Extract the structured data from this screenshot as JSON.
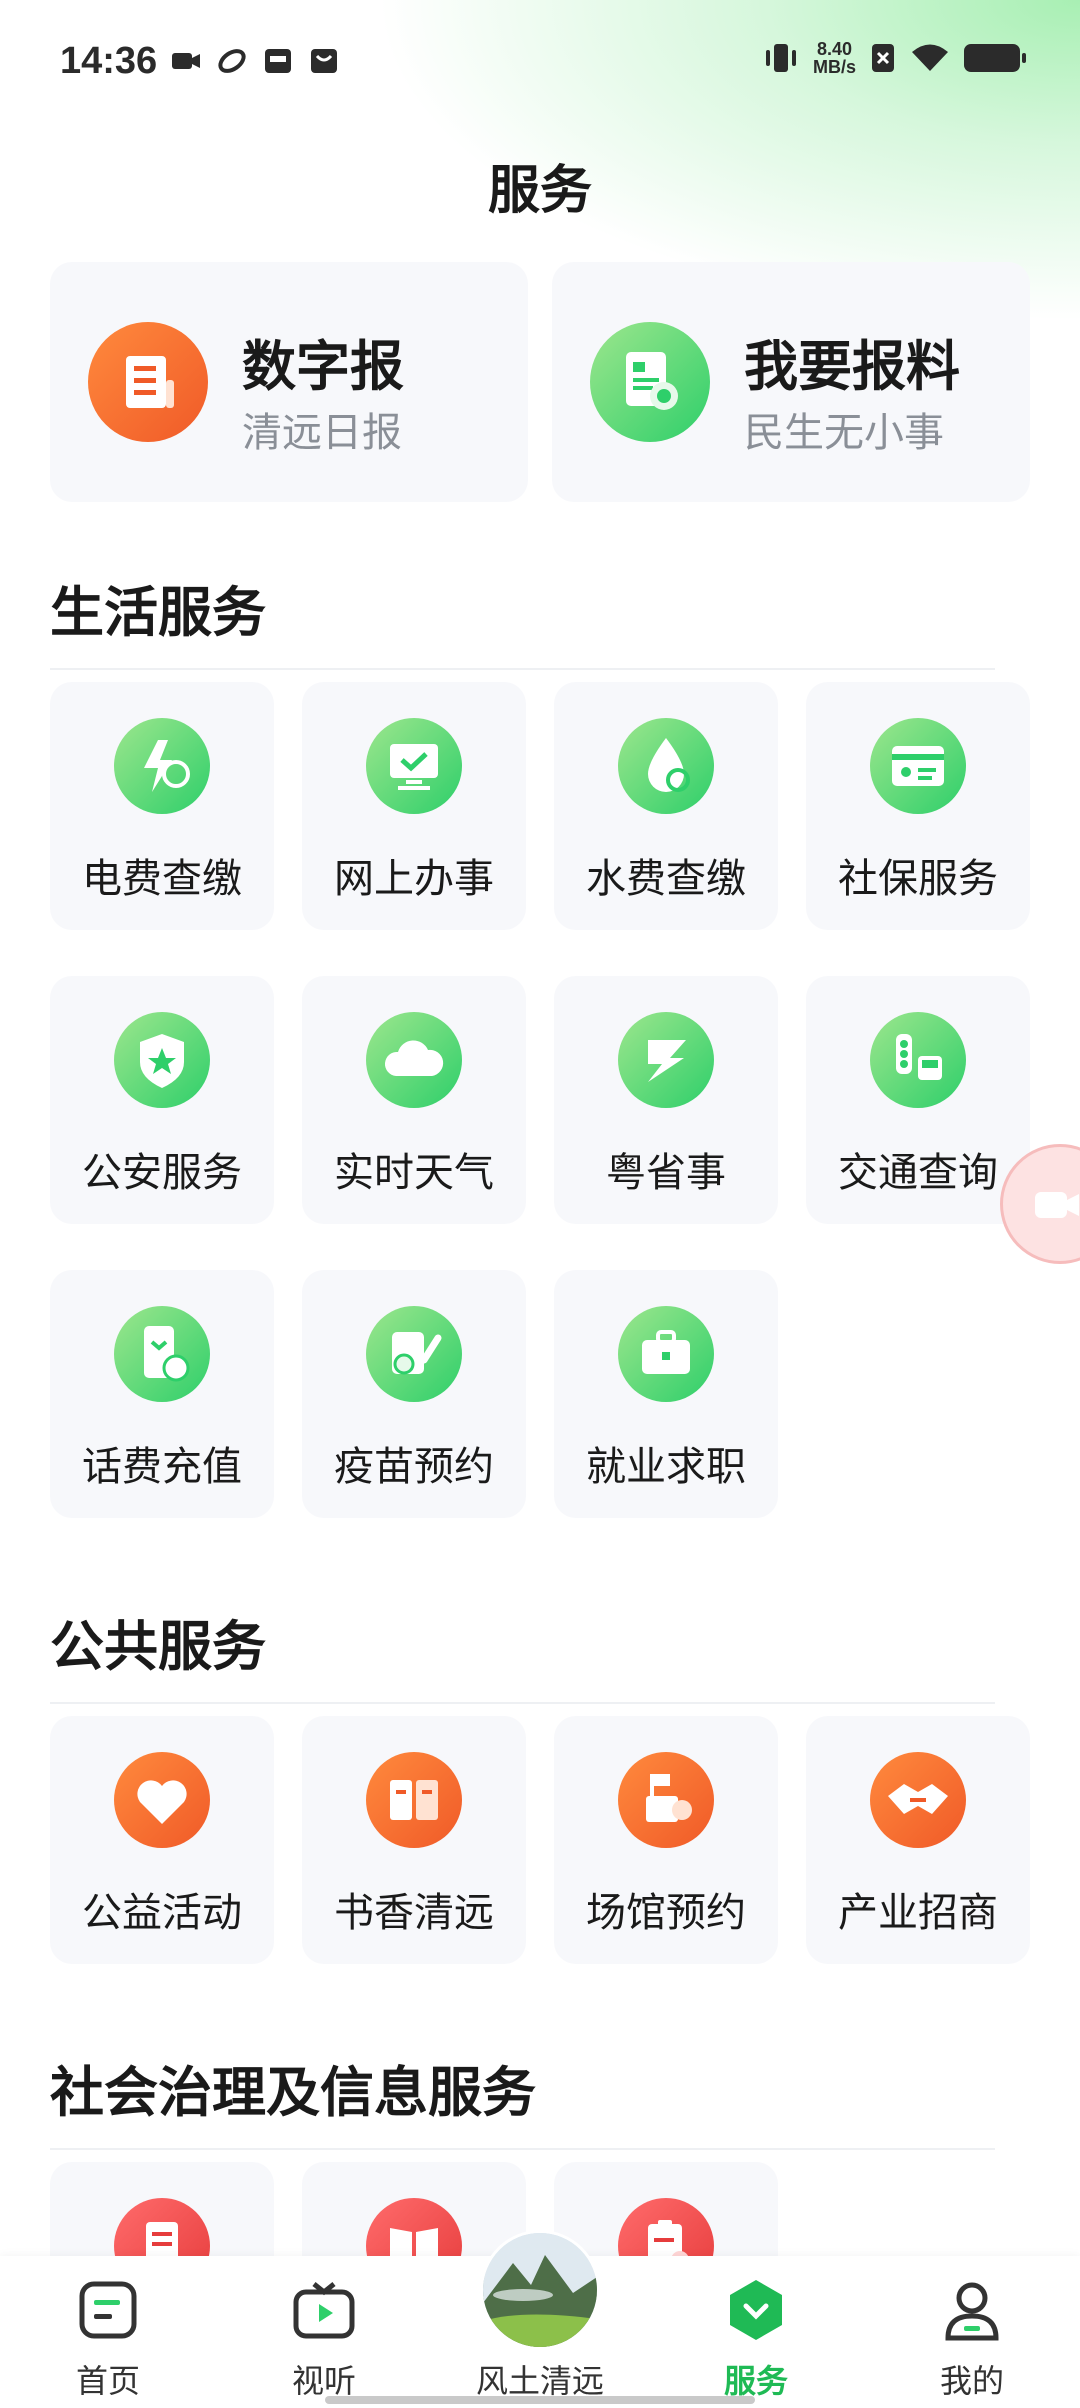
{
  "status_bar": {
    "time": "14:36",
    "net_speed_value": "8.40",
    "net_speed_unit": "MB/s",
    "icons": [
      "video-icon",
      "link-icon",
      "inbox-icon",
      "bag-icon",
      "vibrate-icon",
      "sim-x-icon",
      "wifi-icon",
      "battery-icon"
    ]
  },
  "page": {
    "title": "服务"
  },
  "features": [
    {
      "title": "数字报",
      "subtitle": "清远日报",
      "icon": "scroll-doc-icon",
      "color": "#f05a28"
    },
    {
      "title": "我要报料",
      "subtitle": "民生无小事",
      "icon": "report-call-icon",
      "color": "#2ecf6a"
    }
  ],
  "sections": {
    "life": {
      "title": "生活服务",
      "items": [
        {
          "label": "电费查缴",
          "icon": "electricity-fee-icon"
        },
        {
          "label": "网上办事",
          "icon": "monitor-check-icon"
        },
        {
          "label": "水费查缴",
          "icon": "water-fee-icon"
        },
        {
          "label": "社保服务",
          "icon": "id-card-icon"
        },
        {
          "label": "公安服务",
          "icon": "police-badge-icon"
        },
        {
          "label": "实时天气",
          "icon": "cloud-icon"
        },
        {
          "label": "粤省事",
          "icon": "yue-app-icon"
        },
        {
          "label": "交通查询",
          "icon": "traffic-bus-icon"
        },
        {
          "label": "话费充值",
          "icon": "phone-recharge-icon"
        },
        {
          "label": "疫苗预约",
          "icon": "vaccine-icon"
        },
        {
          "label": "就业求职",
          "icon": "briefcase-icon"
        }
      ]
    },
    "public": {
      "title": "公共服务",
      "items": [
        {
          "label": "公益活动",
          "icon": "heart-icon"
        },
        {
          "label": "书香清远",
          "icon": "book-icon"
        },
        {
          "label": "场馆预约",
          "icon": "venue-icon"
        },
        {
          "label": "产业招商",
          "icon": "handshake-icon"
        }
      ]
    },
    "governance": {
      "title": "社会治理及信息服务",
      "items": [
        {
          "label": "",
          "icon": "document-icon"
        },
        {
          "label": "",
          "icon": "open-book-icon"
        },
        {
          "label": "",
          "icon": "clipboard-icon"
        }
      ]
    }
  },
  "bottom_nav": {
    "items": [
      {
        "label": "首页",
        "icon": "home-doc-icon"
      },
      {
        "label": "视听",
        "icon": "tv-play-icon"
      },
      {
        "label": "风土清远",
        "icon": "landscape-avatar"
      },
      {
        "label": "服务",
        "icon": "service-hex-icon",
        "active": true
      },
      {
        "label": "我的",
        "icon": "person-icon"
      }
    ]
  },
  "colors": {
    "accent": "#1fba55",
    "orange": "#f05a28",
    "green": "#2ecf6a"
  }
}
